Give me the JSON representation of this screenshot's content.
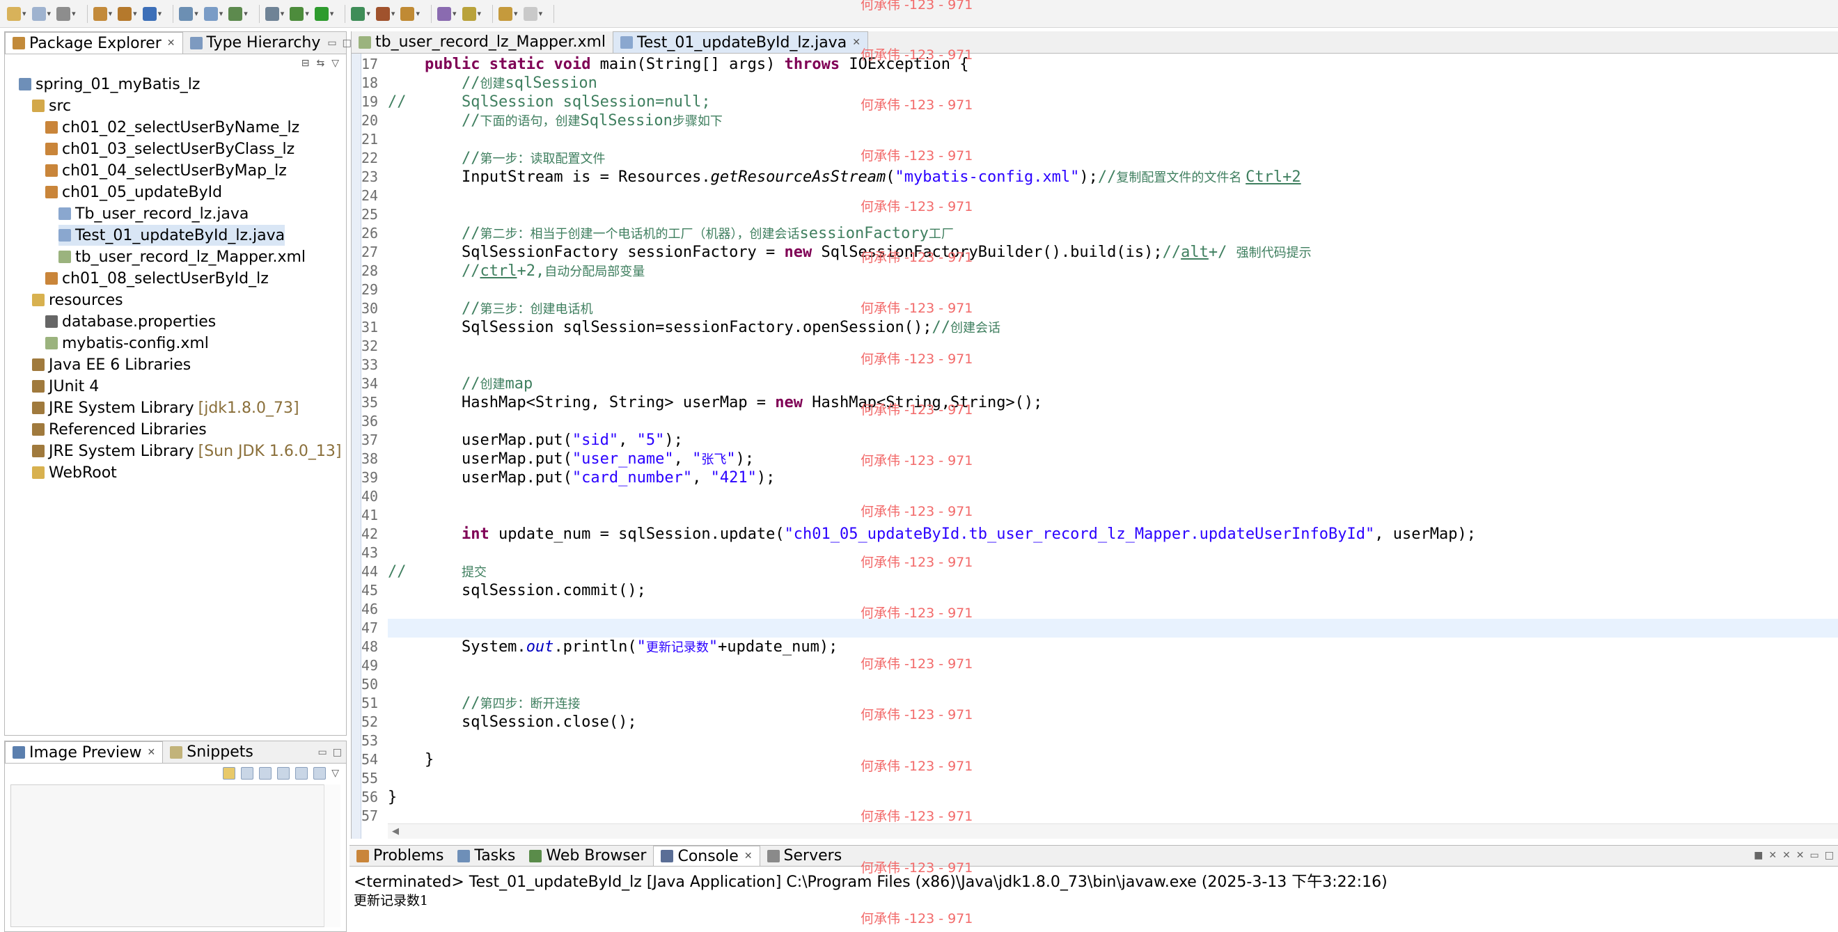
{
  "toolbar": {
    "buttons": [
      {
        "name": "new-icon",
        "color": "#d8b25a"
      },
      {
        "name": "save-icon",
        "color": "#9fb3cf"
      },
      {
        "name": "print-icon",
        "color": "#8d8d8d"
      },
      {
        "name": "new-java-project-icon",
        "color": "#c38a3a"
      },
      {
        "name": "new-package-icon",
        "color": "#b5792c"
      },
      {
        "name": "new-class-icon",
        "color": "#3d6fb8"
      },
      {
        "name": "open-type-icon",
        "color": "#6c8fb3"
      },
      {
        "name": "search-icon",
        "color": "#7a9cc6"
      },
      {
        "name": "deploy-icon",
        "color": "#5d8a4e"
      },
      {
        "name": "server-icon",
        "color": "#6f8396"
      },
      {
        "name": "debug-icon",
        "color": "#4d8c3c"
      },
      {
        "name": "run-icon",
        "color": "#2e9b2e"
      },
      {
        "name": "run-config-icon",
        "color": "#3f8d58"
      },
      {
        "name": "external-tools-icon",
        "color": "#a0522d"
      },
      {
        "name": "perspective-icon",
        "color": "#c08a34"
      },
      {
        "name": "task-icon",
        "color": "#8a6bb0"
      },
      {
        "name": "annotation-icon",
        "color": "#b9a23b"
      },
      {
        "name": "back-icon",
        "color": "#c59a3c"
      },
      {
        "name": "forward-icon",
        "color": "#c9c9c9"
      }
    ]
  },
  "package_explorer": {
    "tab_label": "Package Explorer",
    "tab2_label": "Type Hierarchy",
    "items": [
      {
        "label": "spring_01_myBatis_lz",
        "indent": 0,
        "icon": "project-icon",
        "icon_color": "#6e8fb8",
        "extra": ""
      },
      {
        "label": "src",
        "indent": 1,
        "icon": "source-folder-icon",
        "icon_color": "#d3a84a",
        "extra": ""
      },
      {
        "label": "ch01_02_selectUserByName_lz",
        "indent": 2,
        "icon": "package-icon",
        "icon_color": "#c9853a",
        "extra": ""
      },
      {
        "label": "ch01_03_selectUserByClass_lz",
        "indent": 2,
        "icon": "package-icon",
        "icon_color": "#c9853a",
        "extra": ""
      },
      {
        "label": "ch01_04_selectUserByMap_lz",
        "indent": 2,
        "icon": "package-icon",
        "icon_color": "#c9853a",
        "extra": ""
      },
      {
        "label": "ch01_05_updateById",
        "indent": 2,
        "icon": "package-icon",
        "icon_color": "#c9853a",
        "extra": ""
      },
      {
        "label": "Tb_user_record_lz.java",
        "indent": 3,
        "icon": "java-file-icon",
        "icon_color": "#8aa7cf",
        "extra": ""
      },
      {
        "label": "Test_01_updateById_lz.java",
        "indent": 3,
        "icon": "java-file-icon",
        "icon_color": "#8aa7cf",
        "extra": "",
        "selected": true
      },
      {
        "label": "tb_user_record_lz_Mapper.xml",
        "indent": 3,
        "icon": "xml-file-icon",
        "icon_color": "#9bb37e",
        "extra": ""
      },
      {
        "label": "ch01_08_selectUserById_lz",
        "indent": 2,
        "icon": "package-icon",
        "icon_color": "#c9853a",
        "extra": ""
      },
      {
        "label": "resources",
        "indent": 1,
        "icon": "folder-icon",
        "icon_color": "#d8b14f",
        "extra": ""
      },
      {
        "label": "database.properties",
        "indent": 2,
        "icon": "properties-file-icon",
        "icon_color": "#666666",
        "extra": ""
      },
      {
        "label": "mybatis-config.xml",
        "indent": 2,
        "icon": "xml-file-icon",
        "icon_color": "#9bb37e",
        "extra": ""
      },
      {
        "label": "Java EE 6 Libraries",
        "indent": 1,
        "icon": "library-icon",
        "icon_color": "#a07a3d",
        "extra": ""
      },
      {
        "label": "JUnit 4",
        "indent": 1,
        "icon": "library-icon",
        "icon_color": "#a07a3d",
        "extra": ""
      },
      {
        "label": "JRE System Library",
        "indent": 1,
        "icon": "library-icon",
        "icon_color": "#a07a3d",
        "extra": "[jdk1.8.0_73]"
      },
      {
        "label": "Referenced Libraries",
        "indent": 1,
        "icon": "library-icon",
        "icon_color": "#a07a3d",
        "extra": ""
      },
      {
        "label": "JRE System Library",
        "indent": 1,
        "icon": "library-icon",
        "icon_color": "#a07a3d",
        "extra": "[Sun JDK 1.6.0_13]"
      },
      {
        "label": "WebRoot",
        "indent": 1,
        "icon": "folder-icon",
        "icon_color": "#d8b14f",
        "extra": ""
      }
    ]
  },
  "image_preview": {
    "tab_label": "Image Preview",
    "tab2_label": "Snippets"
  },
  "editor": {
    "tabs": [
      {
        "label": "tb_user_record_lz_Mapper.xml",
        "active": false
      },
      {
        "label": "Test_01_updateById_lz.java",
        "active": true
      }
    ],
    "lines": [
      {
        "no": "17",
        "tokens": [
          {
            "t": "    "
          },
          {
            "t": "public",
            "c": "kw"
          },
          {
            "t": " "
          },
          {
            "t": "static",
            "c": "kw"
          },
          {
            "t": " "
          },
          {
            "t": "void",
            "c": "kw"
          },
          {
            "t": " main(String[] args) "
          },
          {
            "t": "throws",
            "c": "kw"
          },
          {
            "t": " IOException {"
          }
        ]
      },
      {
        "no": "18",
        "tokens": [
          {
            "t": "        "
          },
          {
            "t": "//",
            "c": "cm"
          },
          {
            "t": "创建",
            "c": "cmz"
          },
          {
            "t": "sqlSession",
            "c": "cm"
          }
        ]
      },
      {
        "no": "19",
        "tokens": [
          {
            "t": "//",
            "c": "cm"
          },
          {
            "t": "      SqlSession sqlSession=null;",
            "c": "cm"
          }
        ]
      },
      {
        "no": "20",
        "tokens": [
          {
            "t": "        "
          },
          {
            "t": "//",
            "c": "cm"
          },
          {
            "t": "下面的语句，创建",
            "c": "cmz"
          },
          {
            "t": "SqlSession",
            "c": "cm"
          },
          {
            "t": "步骤如下",
            "c": "cmz"
          }
        ]
      },
      {
        "no": "21",
        "tokens": []
      },
      {
        "no": "22",
        "tokens": [
          {
            "t": "        "
          },
          {
            "t": "//",
            "c": "cm"
          },
          {
            "t": "第一步：读取配置文件",
            "c": "cmz"
          }
        ]
      },
      {
        "no": "23",
        "tokens": [
          {
            "t": "        InputStream is = Resources."
          },
          {
            "t": "getResourceAsStream",
            "c": "it"
          },
          {
            "t": "("
          },
          {
            "t": "\"mybatis-config.xml\"",
            "c": "st"
          },
          {
            "t": ");"
          },
          {
            "t": "//",
            "c": "cm"
          },
          {
            "t": "复制配置文件的文件名 ",
            "c": "cmz"
          },
          {
            "t": "Ctrl+2",
            "c": "cm ul"
          }
        ]
      },
      {
        "no": "24",
        "tokens": []
      },
      {
        "no": "25",
        "tokens": []
      },
      {
        "no": "26",
        "tokens": [
          {
            "t": "        "
          },
          {
            "t": "//",
            "c": "cm"
          },
          {
            "t": "第二步：相当于创建一个电话机的工厂（机器），创建会话",
            "c": "cmz"
          },
          {
            "t": "sessionFactory",
            "c": "cm"
          },
          {
            "t": "工厂",
            "c": "cmz"
          }
        ]
      },
      {
        "no": "27",
        "tokens": [
          {
            "t": "        SqlSessionFactory sessionFactory = "
          },
          {
            "t": "new",
            "c": "kw"
          },
          {
            "t": " SqlSessionFactoryBuilder().build(is);"
          },
          {
            "t": "//",
            "c": "cm"
          },
          {
            "t": "alt",
            "c": "cm ul"
          },
          {
            "t": "+/ ",
            "c": "cm"
          },
          {
            "t": "强制代码提示",
            "c": "cmz"
          }
        ]
      },
      {
        "no": "28",
        "tokens": [
          {
            "t": "        "
          },
          {
            "t": "//",
            "c": "cm"
          },
          {
            "t": "ctrl",
            "c": "cm ul"
          },
          {
            "t": "+2,",
            "c": "cm"
          },
          {
            "t": "自动分配局部变量",
            "c": "cmz"
          }
        ]
      },
      {
        "no": "29",
        "tokens": []
      },
      {
        "no": "30",
        "tokens": [
          {
            "t": "        "
          },
          {
            "t": "//",
            "c": "cm"
          },
          {
            "t": "第三步：创建电话机",
            "c": "cmz"
          }
        ]
      },
      {
        "no": "31",
        "tokens": [
          {
            "t": "        SqlSession sqlSession=sessionFactory.openSession();"
          },
          {
            "t": "//",
            "c": "cm"
          },
          {
            "t": "创建会话",
            "c": "cmz"
          }
        ]
      },
      {
        "no": "32",
        "tokens": []
      },
      {
        "no": "33",
        "tokens": []
      },
      {
        "no": "34",
        "tokens": [
          {
            "t": "        "
          },
          {
            "t": "//",
            "c": "cm"
          },
          {
            "t": "创建",
            "c": "cmz"
          },
          {
            "t": "map",
            "c": "cm"
          }
        ]
      },
      {
        "no": "35",
        "tokens": [
          {
            "t": "        HashMap<String, String> userMap = "
          },
          {
            "t": "new",
            "c": "kw"
          },
          {
            "t": " HashMap<String,String>();"
          }
        ]
      },
      {
        "no": "36",
        "tokens": []
      },
      {
        "no": "37",
        "tokens": [
          {
            "t": "        userMap.put("
          },
          {
            "t": "\"sid\"",
            "c": "st"
          },
          {
            "t": ", "
          },
          {
            "t": "\"5\"",
            "c": "st"
          },
          {
            "t": ");"
          }
        ]
      },
      {
        "no": "38",
        "tokens": [
          {
            "t": "        userMap.put("
          },
          {
            "t": "\"user_name\"",
            "c": "st"
          },
          {
            "t": ", "
          },
          {
            "t": "\"",
            "c": "st"
          },
          {
            "t": "张飞",
            "c": "stz"
          },
          {
            "t": "\"",
            "c": "st"
          },
          {
            "t": ");"
          }
        ]
      },
      {
        "no": "39",
        "tokens": [
          {
            "t": "        userMap.put("
          },
          {
            "t": "\"card_number\"",
            "c": "st"
          },
          {
            "t": ", "
          },
          {
            "t": "\"421\"",
            "c": "st"
          },
          {
            "t": ");"
          }
        ]
      },
      {
        "no": "40",
        "tokens": []
      },
      {
        "no": "41",
        "tokens": []
      },
      {
        "no": "42",
        "tokens": [
          {
            "t": "        "
          },
          {
            "t": "int",
            "c": "kw"
          },
          {
            "t": " update_num = sqlSession.update("
          },
          {
            "t": "\"ch01_05_updateById.tb_user_record_lz_Mapper.updateUserInfoById\"",
            "c": "st"
          },
          {
            "t": ", userMap);"
          }
        ]
      },
      {
        "no": "43",
        "tokens": []
      },
      {
        "no": "44",
        "tokens": [
          {
            "t": "//",
            "c": "cm"
          },
          {
            "t": "      ",
            "c": "cm"
          },
          {
            "t": "提交",
            "c": "cmz"
          }
        ]
      },
      {
        "no": "45",
        "tokens": [
          {
            "t": "        sqlSession.commit();"
          }
        ]
      },
      {
        "no": "46",
        "tokens": []
      },
      {
        "no": "47",
        "tokens": [],
        "current": true
      },
      {
        "no": "48",
        "tokens": [
          {
            "t": "        System."
          },
          {
            "t": "out",
            "c": "fd"
          },
          {
            "t": ".println("
          },
          {
            "t": "\"",
            "c": "st"
          },
          {
            "t": "更新记录数",
            "c": "stz"
          },
          {
            "t": "\"",
            "c": "st"
          },
          {
            "t": "+update_num);"
          }
        ]
      },
      {
        "no": "49",
        "tokens": []
      },
      {
        "no": "50",
        "tokens": []
      },
      {
        "no": "51",
        "tokens": [
          {
            "t": "        "
          },
          {
            "t": "//",
            "c": "cm"
          },
          {
            "t": "第四步：断开连接",
            "c": "cmz"
          }
        ]
      },
      {
        "no": "52",
        "tokens": [
          {
            "t": "        sqlSession.close();"
          }
        ]
      },
      {
        "no": "53",
        "tokens": []
      },
      {
        "no": "54",
        "tokens": [
          {
            "t": "    }"
          }
        ]
      },
      {
        "no": "55",
        "tokens": []
      },
      {
        "no": "56",
        "tokens": [
          {
            "t": "}"
          }
        ]
      },
      {
        "no": "57",
        "tokens": []
      }
    ]
  },
  "console": {
    "tabs": [
      "Problems",
      "Tasks",
      "Web Browser",
      "Console",
      "Servers"
    ],
    "active_tab": "Console",
    "status": "<terminated> Test_01_updateById_lz [Java Application] C:\\Program Files (x86)\\Java\\jdk1.8.0_73\\bin\\javaw.exe (2025-3-13 下午3:22:16)",
    "output": "更新记录数1"
  },
  "watermark": {
    "text": "何承伟 -123 - 971",
    "color": "#f26a6a"
  }
}
